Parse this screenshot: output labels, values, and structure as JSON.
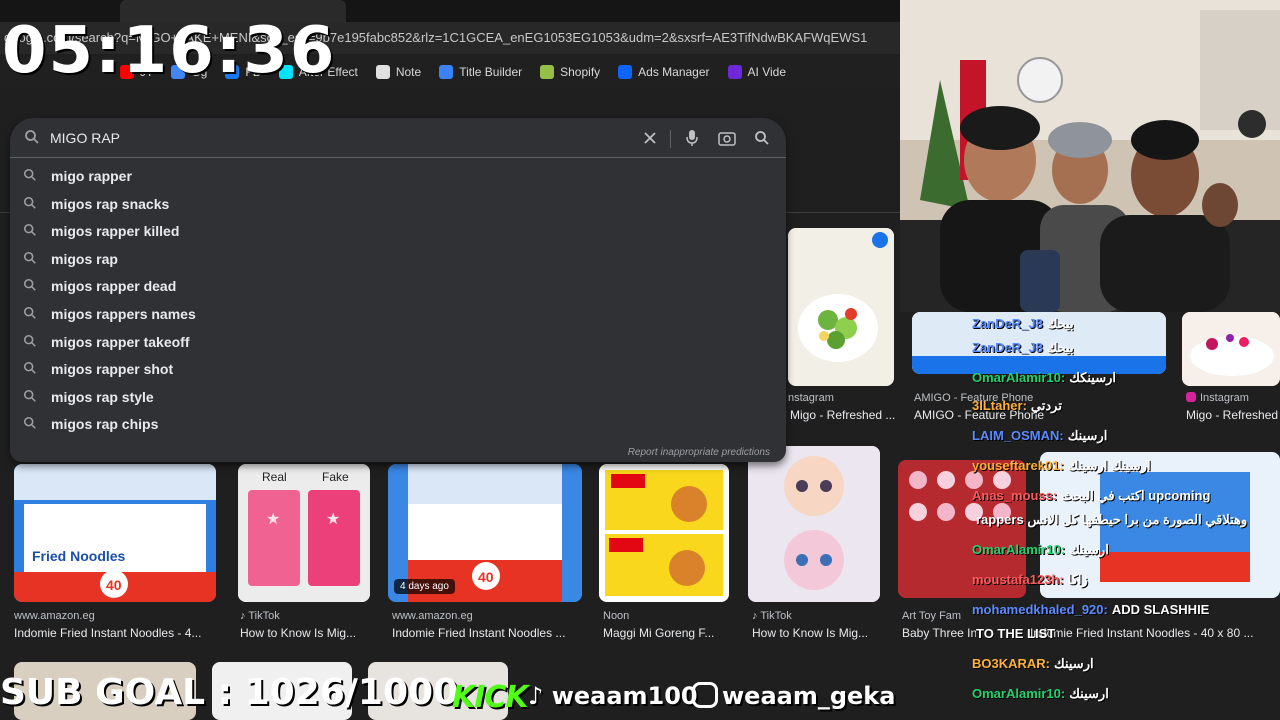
{
  "overlay": {
    "clock": "05:16:36",
    "sub_goal": "SUB GOAL : 1026/1000",
    "kick": "KICK",
    "tiktok_handle": "weaam100",
    "instagram_handle": "weaam_geka"
  },
  "browser": {
    "url": "google.com/search?q=MIGO+FAKE+MENI&sca_esv=9b7e195fabc852&rlz=1C1GCEA_enEG1053EG1053&udm=2&sxsrf=AE3TifNdwBKAFWqEWS1",
    "bookmarks": [
      {
        "label": "JT",
        "color": "#ff0000"
      },
      {
        "label": "Gg",
        "color": "#4285f4"
      },
      {
        "label": "FB",
        "color": "#1877f2"
      },
      {
        "label": "After Effect",
        "color": "#00e5ff"
      },
      {
        "label": "Note",
        "color": "#e0e0e0"
      },
      {
        "label": "Title Builder",
        "color": "#3b82f6"
      },
      {
        "label": "Shopify",
        "color": "#95bf47"
      },
      {
        "label": "Ads Manager",
        "color": "#0a66ff"
      },
      {
        "label": "AI Vide",
        "color": "#6d28d9"
      }
    ]
  },
  "search": {
    "query": "MIGO RAP ",
    "suggestions": [
      "migo rapper",
      "migos rap snacks",
      "migos rapper killed",
      "migos rap",
      "migos rapper dead",
      "migos rappers names",
      "migos rapper takeoff",
      "migos rapper shot",
      "migos rap style",
      "migos rap chips"
    ],
    "report_text": "Report inappropriate predictions"
  },
  "results_row1": [
    {
      "source": "nstagram",
      "title": "Migo - Refreshed ..."
    },
    {
      "source": "AMIGO - Feature Phone",
      "title": "AMIGO - Feature Phone"
    },
    {
      "source": "Instagram",
      "title": "Migo - Refreshed"
    }
  ],
  "results_row2": [
    {
      "source": "www.amazon.eg",
      "title": "Indomie Fried Instant Noodles - 4...",
      "tile_text": "Fried Noodles"
    },
    {
      "source": "TikTok",
      "title": "How to Know Is Mig...",
      "tile_text_real": "Real",
      "tile_text_fake": "Fake"
    },
    {
      "source": "www.amazon.eg",
      "title": "Indomie Fried Instant Noodles ...",
      "badge": "4 days ago"
    },
    {
      "source": "Noon",
      "title": "Maggi Mi Goreng F..."
    },
    {
      "source": "TikTok",
      "title": "How to Know Is Mig..."
    },
    {
      "source": "Art Toy Fam",
      "title": "Baby Three In"
    },
    {
      "source": "",
      "title": "Indomie Fried Instant Noodles - 40 x 80 ..."
    }
  ],
  "chat": [
    {
      "user": "ZanDeR_J8",
      "msg": "بيحك",
      "color": "blue"
    },
    {
      "user": "ZanDeR_J8",
      "msg": "بيحك",
      "color": "blue"
    },
    {
      "user": "OmarAlamir10:",
      "msg": "ارسينكك",
      "color": "green"
    },
    {
      "user": "3ILtaher:",
      "msg": "تردتي",
      "color": "orange"
    },
    {
      "user": "LAIM_OSMAN:",
      "msg": "ارسينك",
      "color": "blue"
    },
    {
      "user": "youseftarek01:",
      "msg": "ارسينك ارسينك",
      "color": "orange"
    },
    {
      "user": "Anas_mouss:",
      "msg": "اكتب في البحث upcoming",
      "color": "red"
    },
    {
      "user": "",
      "msg": "rappers وهتلاقي الصورة من برا حيطفها كل الانس",
      "color": "green"
    },
    {
      "user": "OmarAlamir10:",
      "msg": "ارسينك",
      "color": "green"
    },
    {
      "user": "moustafa123h:",
      "msg": "زاكا",
      "color": "red"
    },
    {
      "user": "mohamedkhaled_920:",
      "msg": "ADD SLASHHIE",
      "color": "blue"
    },
    {
      "user": "",
      "msg": "TO THE LIST",
      "color": "green"
    },
    {
      "user": "BO3KARAR:",
      "msg": "ارسينك",
      "color": "orange"
    },
    {
      "user": "OmarAlamir10:",
      "msg": "ارسينك",
      "color": "green"
    }
  ]
}
